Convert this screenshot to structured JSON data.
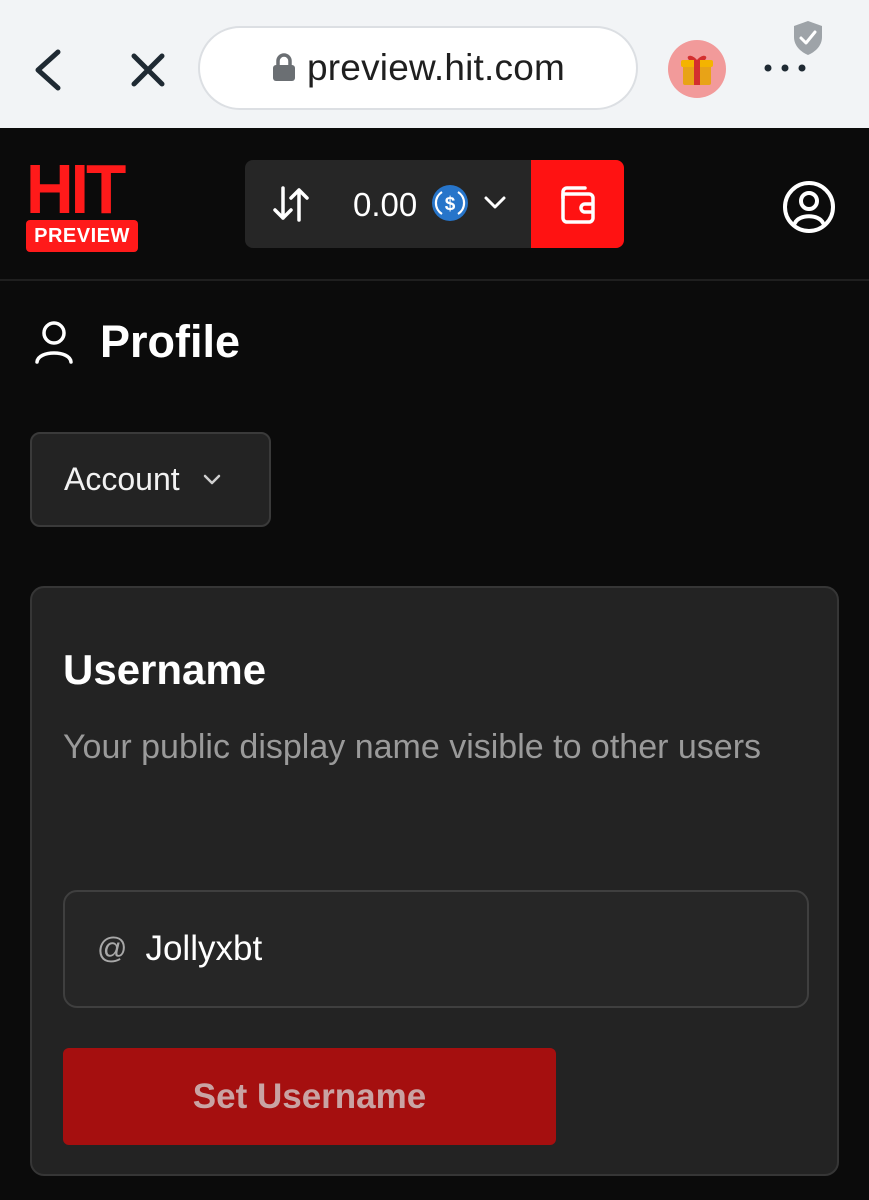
{
  "browser": {
    "url": "preview.hit.com"
  },
  "header": {
    "logo_text": "HIT",
    "logo_badge": "PREVIEW",
    "balance": "0.00",
    "colors": {
      "accent": "#ff1212",
      "background": "#0b0b0b"
    }
  },
  "page": {
    "title": "Profile",
    "section_dropdown": "Account"
  },
  "username_card": {
    "heading": "Username",
    "description": "Your public display name visible to other users",
    "prefix": "@",
    "value": "Jollyxbt",
    "button_label": "Set Username"
  }
}
